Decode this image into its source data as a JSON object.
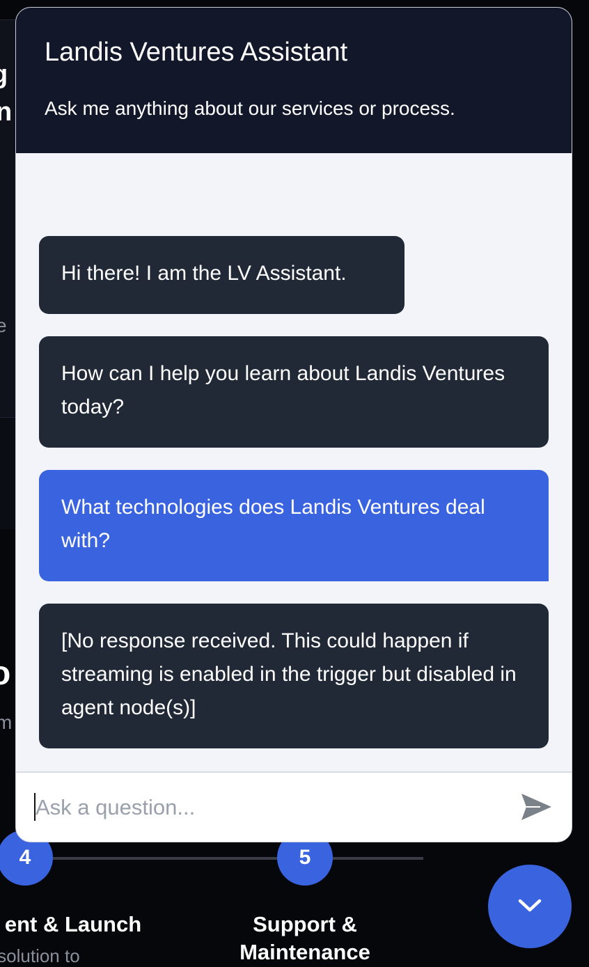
{
  "background": {
    "fragments": {
      "heading_a": "g",
      "heading_b": "n",
      "text_a": "e",
      "heading_c": "o",
      "text_b": "m"
    },
    "steps": [
      {
        "number": "4",
        "title": "ent & Launch",
        "description": "he solution to"
      },
      {
        "number": "5",
        "title": "Support & Maintenance"
      }
    ]
  },
  "chat": {
    "title": "Landis Ventures Assistant",
    "subtitle": "Ask me anything about our services or process.",
    "messages": [
      {
        "role": "bot",
        "text": "Hi there! I am the LV Assistant."
      },
      {
        "role": "bot",
        "text": "How can I help you learn about Landis Ventures today?"
      },
      {
        "role": "user",
        "text": "What technologies does Landis Ventures deal with?"
      },
      {
        "role": "bot",
        "text": "[No response received. This could happen if streaming is enabled in the trigger but disabled in agent node(s)]"
      }
    ],
    "input": {
      "value": "",
      "placeholder": "Ask a question..."
    },
    "send_icon": "send-icon",
    "toggle_icon": "chevron-down-icon"
  },
  "colors": {
    "header_bg": "#121829",
    "bot_bubble": "#212937",
    "user_bubble": "#3a63e0",
    "accent": "#3a63e0"
  }
}
